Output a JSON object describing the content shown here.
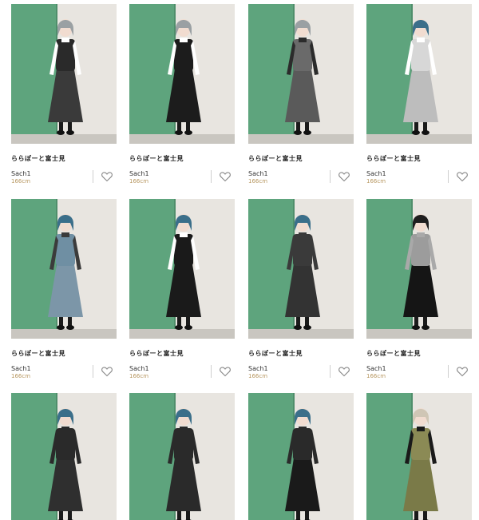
{
  "colors": {
    "wall_green": "#5ea47d",
    "wall_light": "#e8e5e0",
    "height_text": "#b89862"
  },
  "cards": [
    {
      "store": "ららぽーと富士見",
      "user": "Sach1",
      "height": "166cm",
      "favorite_icon": "heart-outline-icon",
      "hair": "#9aa0a3",
      "top": "#ffffff",
      "outfit": "#2a2a2a",
      "skirt": "#3a3a3a"
    },
    {
      "store": "ららぽーと富士見",
      "user": "Sach1",
      "height": "166cm",
      "favorite_icon": "heart-outline-icon",
      "hair": "#9aa0a3",
      "top": "#ffffff",
      "outfit": "#1c1c1c",
      "skirt": "#1c1c1c"
    },
    {
      "store": "ららぽーと富士見",
      "user": "Sach1",
      "height": "166cm",
      "favorite_icon": "heart-outline-icon",
      "hair": "#9aa0a3",
      "top": "#2b2b2b",
      "outfit": "#6a6a6a",
      "skirt": "#5a5a5a"
    },
    {
      "store": "ららぽーと富士見",
      "user": "Sach1",
      "height": "166cm",
      "favorite_icon": "heart-outline-icon",
      "hair": "#3b6f8a",
      "top": "#ffffff",
      "outfit": "#d7d7d7",
      "skirt": "#bdbdbd"
    },
    {
      "store": "ららぽーと富士見",
      "user": "Sach1",
      "height": "166cm",
      "favorite_icon": "heart-outline-icon",
      "hair": "#3b6f8a",
      "top": "#3b3b3b",
      "outfit": "#6f8fa3",
      "skirt": "#7c96a8"
    },
    {
      "store": "ららぽーと富士見",
      "user": "Sach1",
      "height": "166cm",
      "favorite_icon": "heart-outline-icon",
      "hair": "#3b6f8a",
      "top": "#ffffff",
      "outfit": "#1a1a1a",
      "skirt": "#1a1a1a"
    },
    {
      "store": "ららぽーと富士見",
      "user": "Sach1",
      "height": "166cm",
      "favorite_icon": "heart-outline-icon",
      "hair": "#3b6f8a",
      "top": "#3a3a3a",
      "outfit": "#3a3a3a",
      "skirt": "#333333"
    },
    {
      "store": "ららぽーと富士見",
      "user": "Sach1",
      "height": "166cm",
      "favorite_icon": "heart-outline-icon",
      "hair": "#1e1e1e",
      "top": "#a9a9a9",
      "outfit": "#9c9c9c",
      "skirt": "#151515"
    },
    {
      "store": "",
      "user": "",
      "height": "",
      "favorite_icon": "",
      "hair": "#3b6f8a",
      "top": "#2a2a2a",
      "outfit": "#2a2a2a",
      "skirt": "#2f2f2f"
    },
    {
      "store": "",
      "user": "",
      "height": "",
      "favorite_icon": "",
      "hair": "#3b6f8a",
      "top": "#2a2a2a",
      "outfit": "#2a2a2a",
      "skirt": "#2a2a2a"
    },
    {
      "store": "",
      "user": "",
      "height": "",
      "favorite_icon": "",
      "hair": "#3b6f8a",
      "top": "#2a2a2a",
      "outfit": "#2a2a2a",
      "skirt": "#1a1a1a"
    },
    {
      "store": "",
      "user": "",
      "height": "",
      "favorite_icon": "",
      "hair": "#cfc6b5",
      "top": "#1a1a1a",
      "outfit": "#8b8a55",
      "skirt": "#7a7a48"
    }
  ]
}
